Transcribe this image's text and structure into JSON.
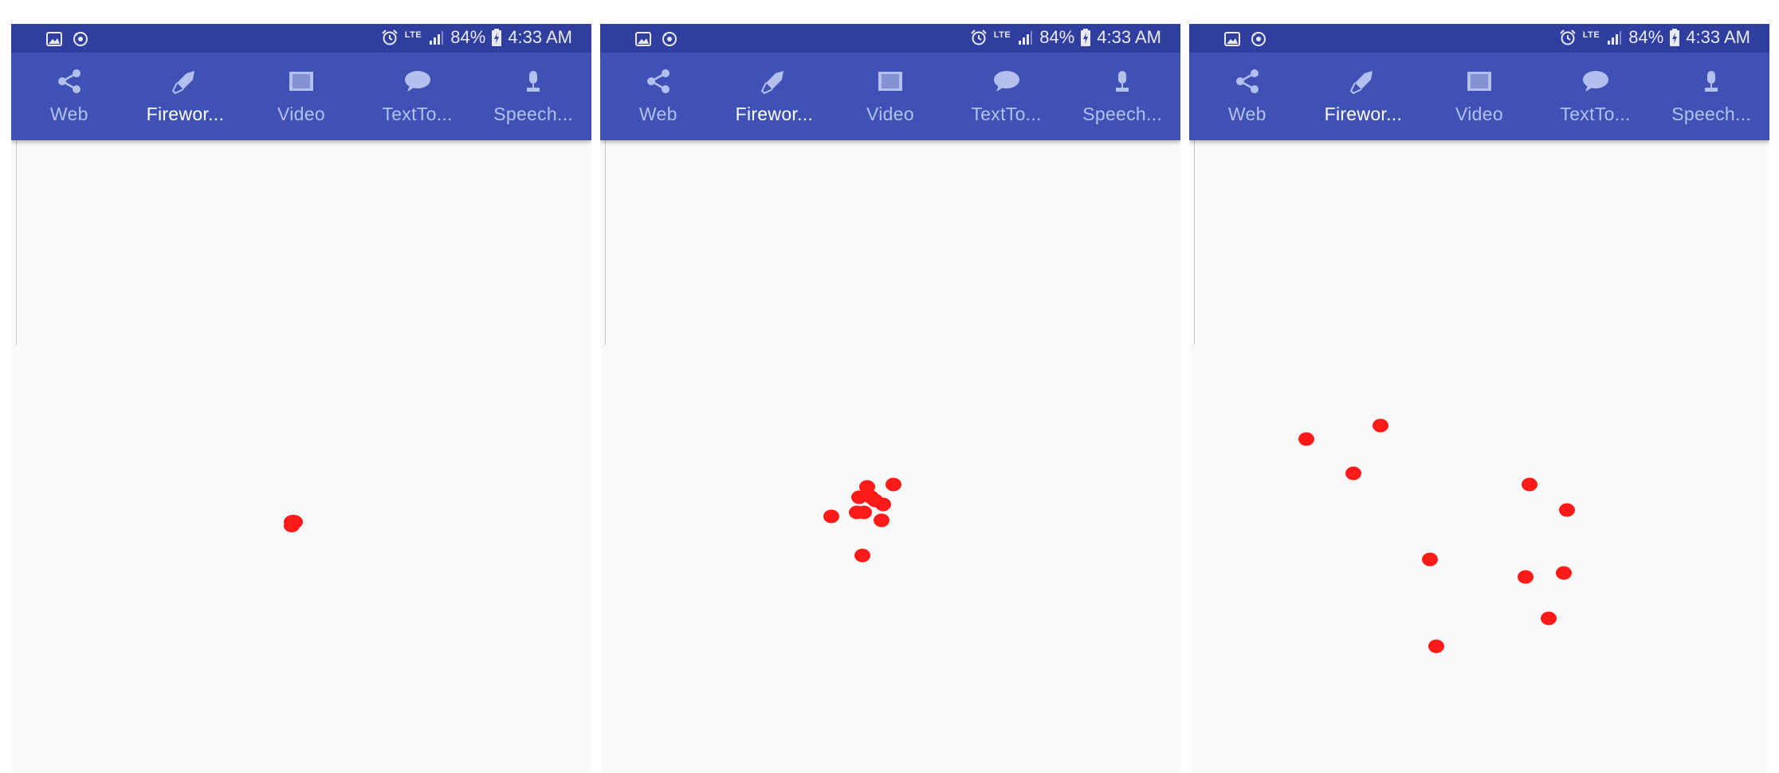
{
  "status_bar": {
    "left_icons": [
      "image-icon",
      "sync-icon"
    ],
    "alarm_icon": "alarm-icon",
    "network": "LTE",
    "signal_icon": "signal-icon",
    "battery_percent": "84%",
    "battery_icon": "battery-charging-icon",
    "time": "4:33 AM",
    "text_color": "#e8eaf6",
    "background": "#303f9f"
  },
  "tab_bar": {
    "background": "#3f51b5",
    "unselected_color": "#b3c0ee",
    "selected_color": "#ffffff",
    "tabs": [
      {
        "label": "Web",
        "icon": "share-icon"
      },
      {
        "label": "Firewor...",
        "icon": "rocket-icon",
        "selected": true
      },
      {
        "label": "Video",
        "icon": "film-icon"
      },
      {
        "label": "TextTo...",
        "icon": "speech-bubble-icon"
      },
      {
        "label": "Speech...",
        "icon": "microphone-icon"
      }
    ]
  },
  "particle_color": "#ff1a1a",
  "screens": [
    {
      "frame": 1,
      "particle_count": 2
    },
    {
      "frame": 2,
      "particle_count": 11
    },
    {
      "frame": 3,
      "particle_count": 11
    }
  ]
}
